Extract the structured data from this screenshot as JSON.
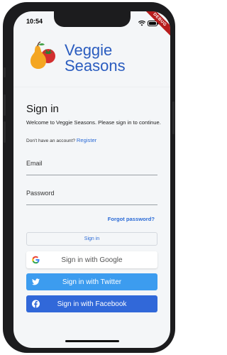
{
  "status_bar": {
    "time": "10:54"
  },
  "debug_banner": "DEBUG",
  "app": {
    "name_line1": "Veggie",
    "name_line2": "Seasons"
  },
  "signin": {
    "title": "Sign in",
    "welcome": "Welcome to Veggie Seasons. Please sign in to continue.",
    "no_account_text": "Don't have an account?",
    "register_link": "Register",
    "email_label": "Email",
    "password_label": "Password",
    "forgot_password": "Forgot password?",
    "sign_in_button": "Sign in",
    "google_button": "Sign in with Google",
    "twitter_button": "Sign in with Twitter",
    "facebook_button": "Sign in with Facebook"
  },
  "colors": {
    "brand": "#2a5cbf",
    "link": "#2a6ad6",
    "twitter": "#3c9cef",
    "facebook": "#3168d9",
    "debug": "#b71c1c"
  },
  "icons": [
    "wifi-icon",
    "battery-icon",
    "pear-icon",
    "tomato-icon",
    "google-icon",
    "twitter-icon",
    "facebook-icon"
  ]
}
